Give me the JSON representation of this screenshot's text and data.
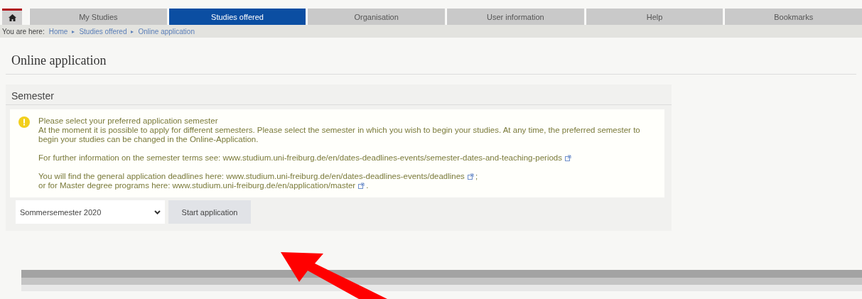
{
  "nav": {
    "tabs": [
      {
        "label": "My Studies",
        "selected": false
      },
      {
        "label": "Studies offered",
        "selected": true
      },
      {
        "label": "Organisation",
        "selected": false
      },
      {
        "label": "User information",
        "selected": false
      },
      {
        "label": "Help",
        "selected": false
      },
      {
        "label": "Bookmarks",
        "selected": false
      }
    ]
  },
  "breadcrumb": {
    "prefix": "You are here:",
    "items": [
      "Home",
      "Studies offered",
      "Online application"
    ],
    "separator": "▸"
  },
  "page_title": "Online application",
  "section": {
    "title": "Semester",
    "info": {
      "heading": "Please select your preferred application semester",
      "paragraphs": [
        {
          "lines": [
            {
              "text": "At the moment it is possible to apply for different semesters. Please select the semester in which you wish to begin your studies. At any time, the preferred semester to begin your studies can be changed in the Online-Application.",
              "external_link": false
            }
          ]
        },
        {
          "lines": [
            {
              "text": "For further information on the semester terms see: www.studium.uni-freiburg.de/en/dates-deadlines-events/semester-dates-and-teaching-periods",
              "external_link": true
            }
          ]
        },
        {
          "lines": [
            {
              "text": "You will find the general application deadlines here:  www.studium.uni-freiburg.de/en/dates-deadlines-events/deadlines",
              "external_link": true,
              "after": ";"
            },
            {
              "text": "or for Master degree programs here: www.studium.uni-freiburg.de/en/application/master",
              "external_link": true,
              "after": "."
            }
          ]
        }
      ]
    },
    "semester_select": {
      "value": "Sommersemester 2020"
    },
    "start_button": "Start application"
  }
}
